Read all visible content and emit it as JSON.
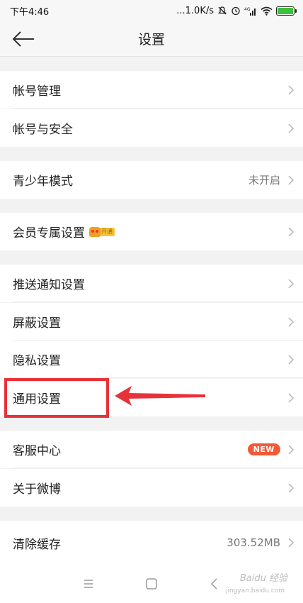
{
  "status_bar": {
    "time": "下午4:46",
    "net_speed": "...1.0K/s"
  },
  "header": {
    "title": "设置"
  },
  "settings": [
    {
      "label": "帐号管理"
    },
    {
      "label": "帐号与安全"
    },
    {
      "label": "青少年模式",
      "value": "未开启"
    },
    {
      "label": "会员专属设置",
      "badge": "开通"
    },
    {
      "label": "推送通知设置"
    },
    {
      "label": "屏蔽设置"
    },
    {
      "label": "隐私设置"
    },
    {
      "label": "通用设置"
    },
    {
      "label": "客服中心",
      "badge": "NEW"
    },
    {
      "label": "关于微博"
    },
    {
      "label": "清除缓存",
      "value": "303.52MB"
    }
  ],
  "watermark": {
    "brand": "Baidu 经验",
    "url": "jingyan.baidu.com"
  },
  "colors": {
    "highlight": "#e8323a",
    "new_badge": "#f25a36",
    "battery": "#3cc13c"
  }
}
